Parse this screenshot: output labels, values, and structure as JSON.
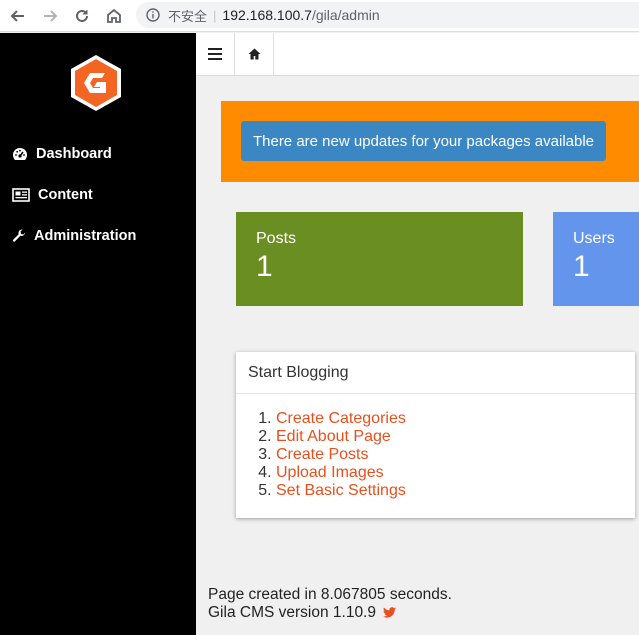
{
  "browser": {
    "security_label": "不安全",
    "url_host": "192.168.100.7",
    "url_path": "/gila/admin"
  },
  "sidebar": {
    "items": [
      {
        "label": "Dashboard",
        "icon": "tachometer-icon"
      },
      {
        "label": "Content",
        "icon": "newspaper-icon"
      },
      {
        "label": "Administration",
        "icon": "wrench-icon"
      }
    ]
  },
  "toolbar": {
    "menu_icon": "hamburger-icon",
    "home_icon": "home-icon"
  },
  "banner": {
    "text": "There are new updates for your packages available",
    "color": "#ff8c00",
    "button_color": "#3b87c4"
  },
  "stats": [
    {
      "label": "Posts",
      "value": "1",
      "color": "#6b8e23"
    },
    {
      "label": "Users",
      "value": "1",
      "color": "#6495ed"
    }
  ],
  "start_card": {
    "title": "Start Blogging",
    "items": [
      "Create Categories",
      "Edit About Page",
      "Create Posts",
      "Upload Images",
      "Set Basic Settings"
    ],
    "link_color": "#e8501e"
  },
  "footer": {
    "line1": "Page created in 8.067805 seconds.",
    "line2": "Gila CMS version 1.10.9"
  }
}
